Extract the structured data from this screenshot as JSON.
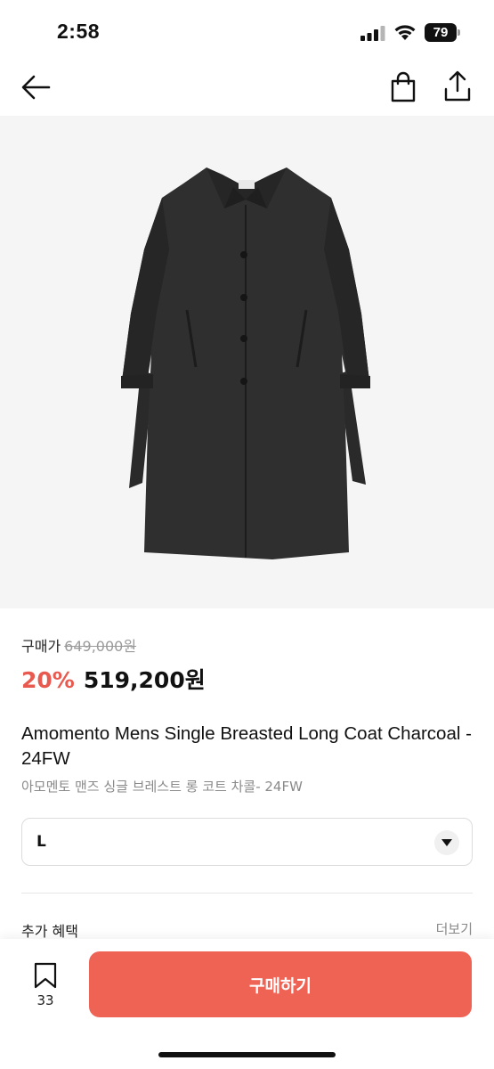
{
  "status_bar": {
    "time": "2:58",
    "battery_level": "79"
  },
  "nav": {
    "back_icon": "arrow-left-icon",
    "bag_icon": "shopping-bag-icon",
    "share_icon": "share-icon"
  },
  "product": {
    "image_alt_icon": "coat-image",
    "price_label": "구매가",
    "original_price": "649,000원",
    "discount": "20%",
    "sale_price": "519,200원",
    "title_en": "Amomento Mens Single Breasted Long Coat Charcoal - 24FW",
    "title_ko": "아모멘토 맨즈 싱글 브레스트 롱 코트 차콜- 24FW"
  },
  "option": {
    "selected_size": "L",
    "dropdown_icon": "triangle-down-icon"
  },
  "benefits": {
    "title": "추가 혜택",
    "more": "더보기"
  },
  "bottom_bar": {
    "bookmark_count": "33",
    "buy_label": "구매하기"
  },
  "colors": {
    "accent": "#ef6354",
    "discount": "#e85a4f",
    "muted_text": "#8a8a8a"
  }
}
